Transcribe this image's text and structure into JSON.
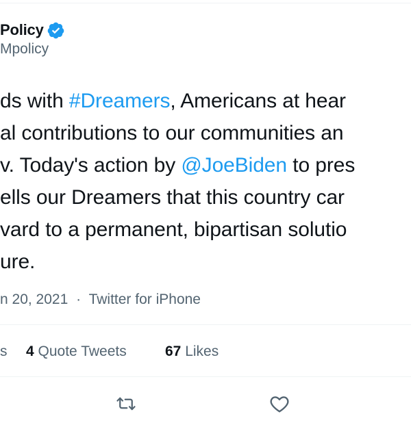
{
  "author": {
    "name": "Policy",
    "handle": "Mpolicy"
  },
  "tweet": {
    "lines": [
      [
        {
          "t": "ds with "
        },
        {
          "t": "#Dreamers",
          "link": true
        },
        {
          "t": ", Americans at hear"
        }
      ],
      [
        {
          "t": "al contributions to our communities an"
        }
      ],
      [
        {
          "t": "v. Today's action by "
        },
        {
          "t": "@JoeBiden",
          "link": true
        },
        {
          "t": " to pres"
        }
      ],
      [
        {
          "t": "ells our Dreamers that this country car"
        }
      ],
      [
        {
          "t": "vard to a permanent, bipartisan solutio"
        }
      ],
      [
        {
          "t": "ure."
        }
      ]
    ]
  },
  "meta": {
    "date": "n 20, 2021",
    "separator": "·",
    "source": "Twitter for iPhone"
  },
  "stats": {
    "retweets_label": "s",
    "quote_count": "4",
    "quote_label": "Quote Tweets",
    "likes_count": "67",
    "likes_label": "Likes"
  },
  "actions": {
    "retweet_icon": "retweet-icon",
    "like_icon": "heart-icon"
  },
  "colors": {
    "link": "#1d9bf0",
    "secondary": "#536471",
    "divider": "#eff3f4",
    "text": "#0f1419"
  }
}
